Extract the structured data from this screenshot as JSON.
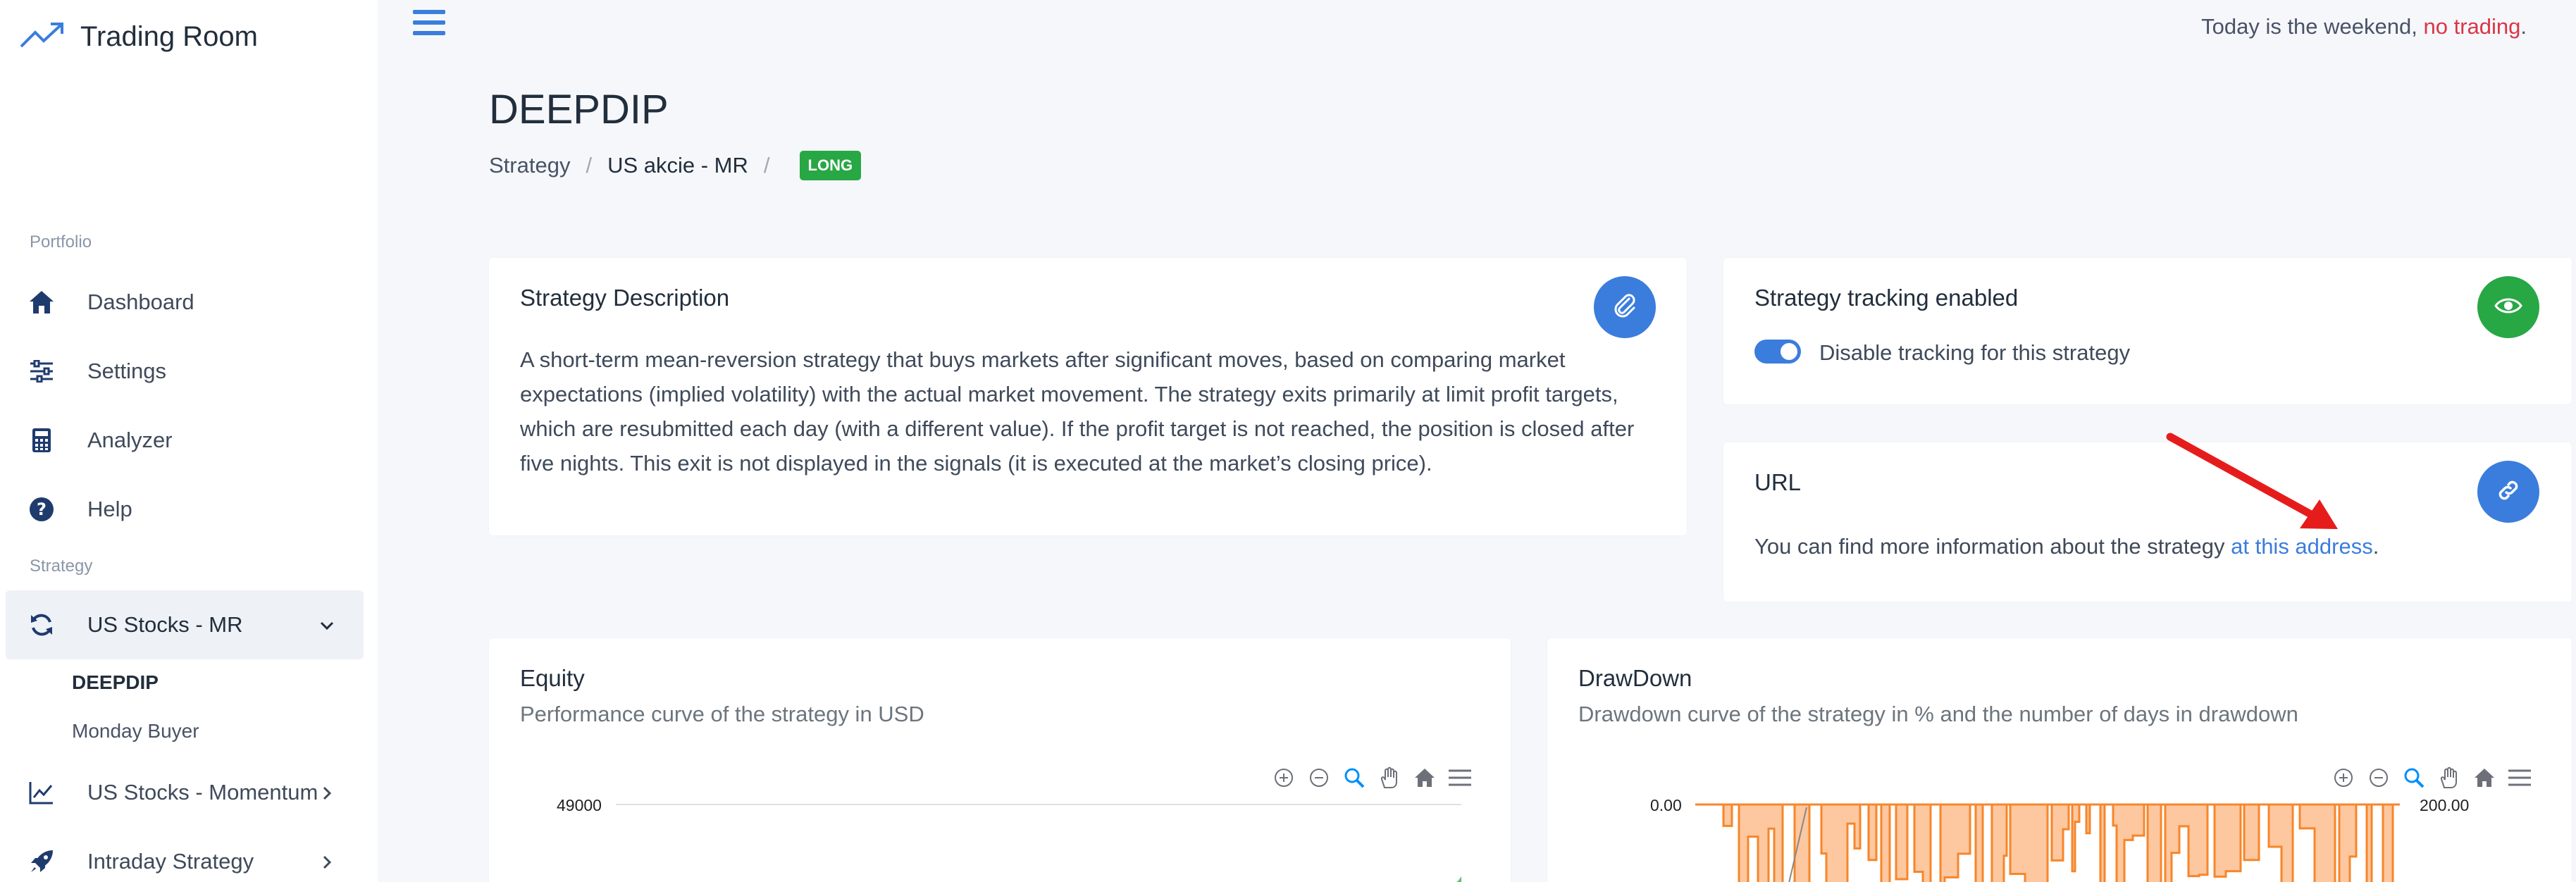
{
  "app": {
    "title": "Trading Room"
  },
  "sidebar": {
    "section_portfolio": "Portfolio",
    "items": [
      {
        "label": "Dashboard",
        "icon": "home-icon"
      },
      {
        "label": "Settings",
        "icon": "sliders-icon"
      },
      {
        "label": "Analyzer",
        "icon": "calculator-icon"
      },
      {
        "label": "Help",
        "icon": "question-circle-icon"
      }
    ],
    "section_strategy": "Strategy",
    "strategy_groups": [
      {
        "label": "US Stocks - MR",
        "expanded": true,
        "sub": [
          "DEEPDIP",
          "Monday Buyer"
        ]
      },
      {
        "label": "US Stocks - Momentum",
        "expanded": false
      },
      {
        "label": "Intraday Strategy",
        "expanded": false
      }
    ]
  },
  "topbar": {
    "weekend_prefix": "Today is the weekend,",
    "weekend_alert": "no trading",
    "weekend_suffix": "."
  },
  "page": {
    "title": "DEEPDIP",
    "breadcrumb": [
      "Strategy",
      "US akcie - MR"
    ],
    "badge": "LONG"
  },
  "description_card": {
    "title": "Strategy Description",
    "text": "A short-term mean-reversion strategy that buys markets after significant moves, based on comparing market expectations (implied volatility) with the actual market movement. The strategy exits primarily at limit profit targets, which are resubmitted each day (with a different value). If the profit target is not reached, the position is closed after five nights. This exit is not displayed in the signals (it is executed at the market’s closing price)."
  },
  "tracking_card": {
    "title": "Strategy tracking enabled",
    "toggle_label": "Disable tracking for this strategy",
    "toggle_on": true
  },
  "url_card": {
    "title": "URL",
    "text_prefix": "You can find more information about the strategy",
    "link_text": "at this address",
    "text_suffix": "."
  },
  "equity_card": {
    "title": "Equity",
    "subtitle": "Performance curve of the strategy in USD",
    "ytick_top": "49000"
  },
  "drawdown_card": {
    "title": "DrawDown",
    "subtitle": "Drawdown curve of the strategy in % and the number of days in drawdown",
    "ytick_left": "0.00",
    "ytick_right": "200.00"
  },
  "colors": {
    "accent": "#3b7ddd",
    "success": "#28a745",
    "danger": "#dc3545",
    "drawdown": "#fd7e14"
  }
}
